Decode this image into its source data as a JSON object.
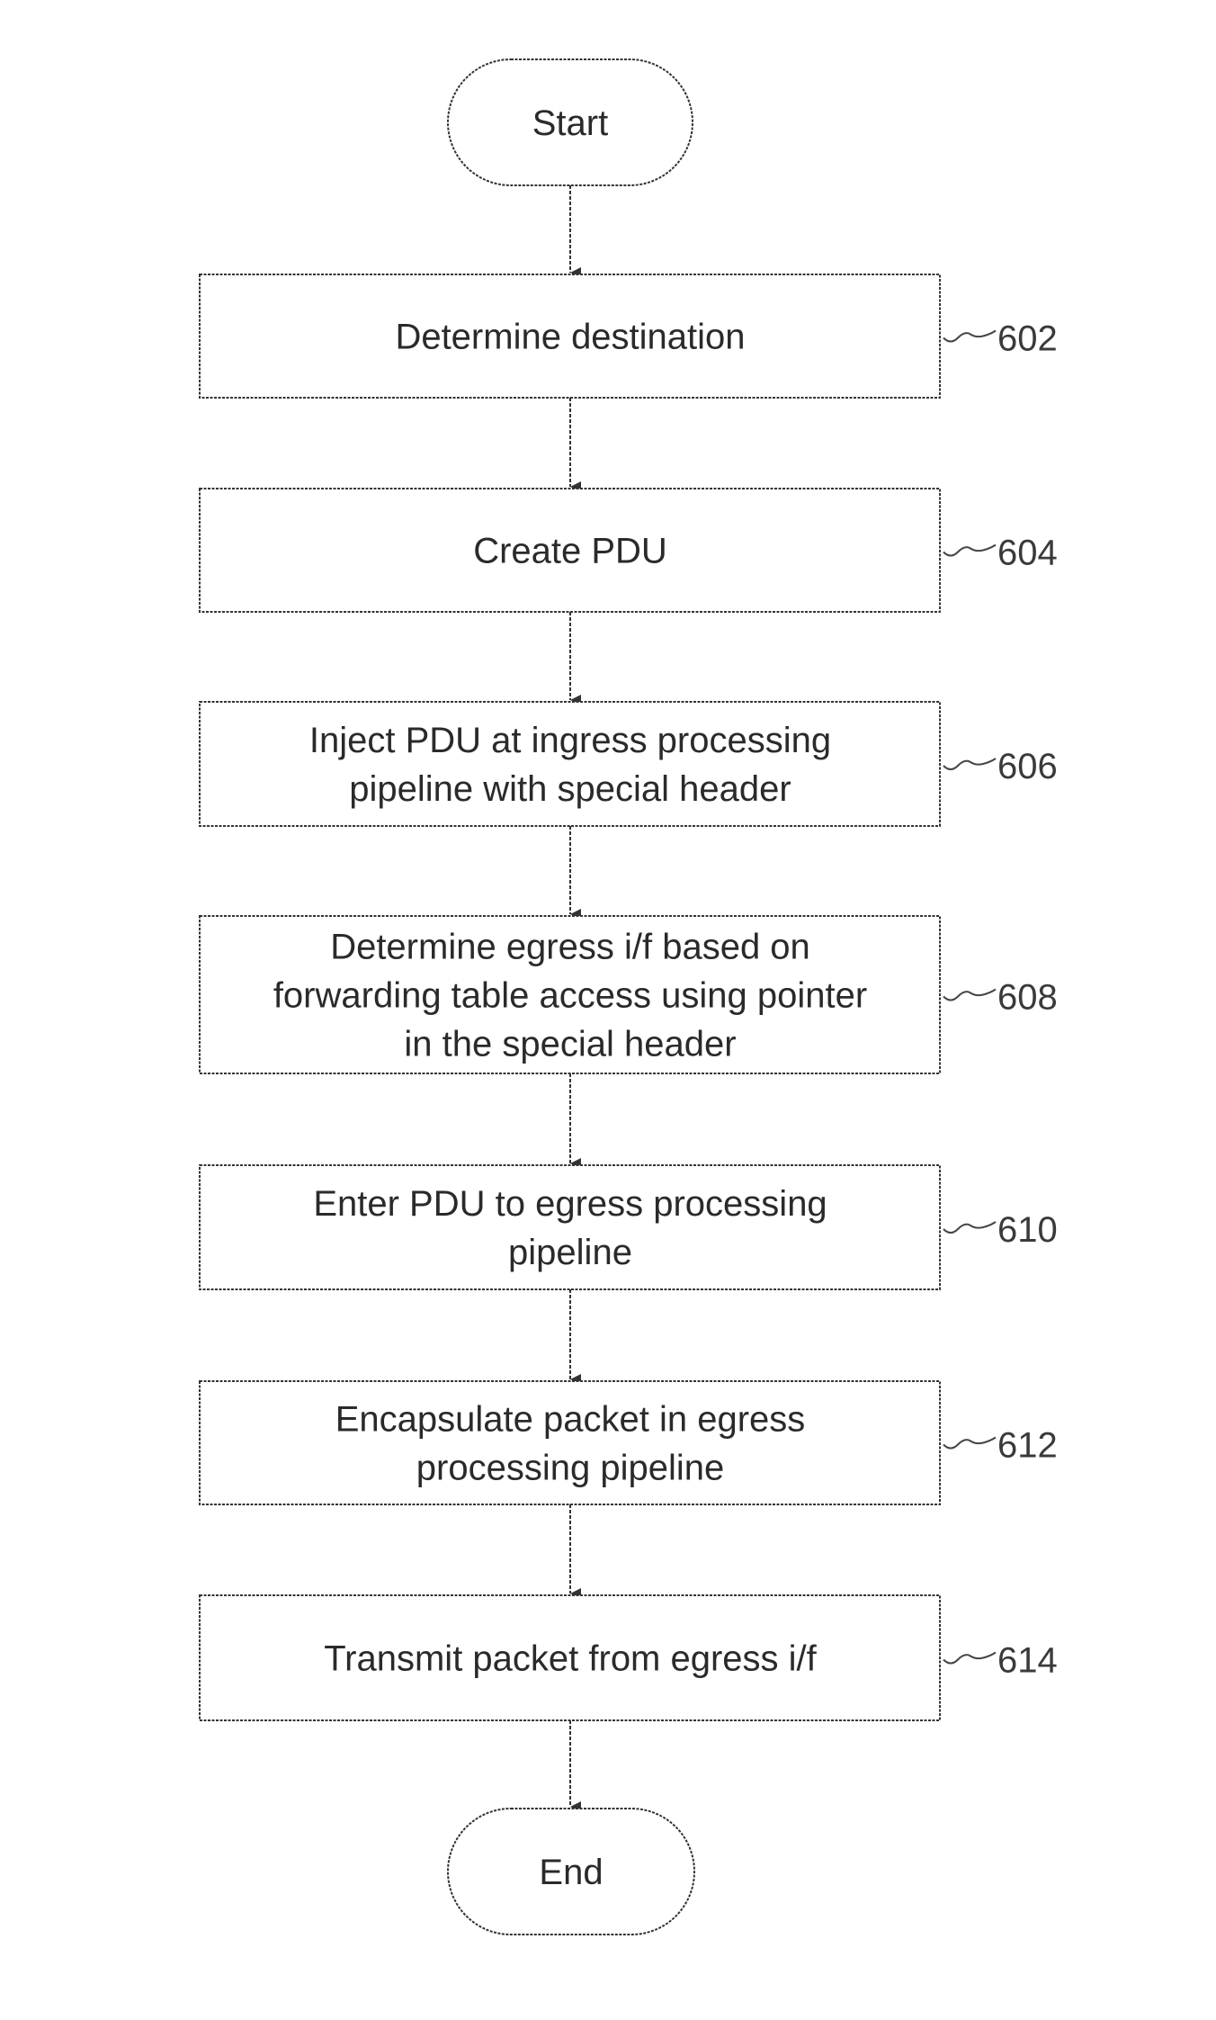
{
  "figure": {
    "type": "flowchart",
    "start": {
      "label": "Start"
    },
    "end": {
      "label": "End"
    },
    "steps": [
      {
        "ref": "602",
        "lines": [
          "Determine destination"
        ]
      },
      {
        "ref": "604",
        "lines": [
          "Create PDU"
        ]
      },
      {
        "ref": "606",
        "lines": [
          "Inject PDU at ingress processing",
          "pipeline with special header"
        ]
      },
      {
        "ref": "608",
        "lines": [
          "Determine egress i/f based on",
          "forwarding table access using pointer",
          "in the special header"
        ]
      },
      {
        "ref": "610",
        "lines": [
          "Enter PDU to egress processing",
          "pipeline"
        ]
      },
      {
        "ref": "612",
        "lines": [
          "Encapsulate packet in egress",
          "processing pipeline"
        ]
      },
      {
        "ref": "614",
        "lines": [
          "Transmit packet from egress i/f"
        ]
      }
    ],
    "colors": {
      "stroke": "#333333",
      "text": "#2a2a2a",
      "background": "#ffffff"
    }
  }
}
